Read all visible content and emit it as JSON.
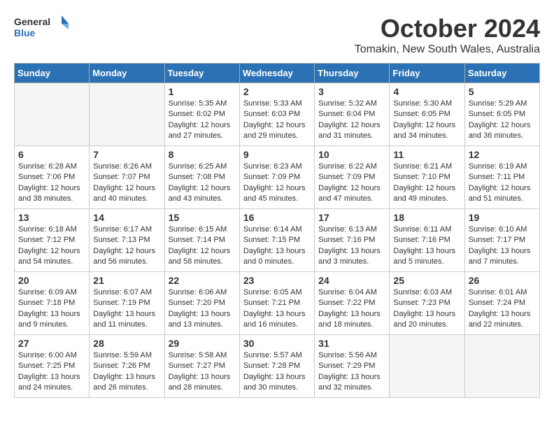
{
  "header": {
    "logo_line1": "General",
    "logo_line2": "Blue",
    "month": "October 2024",
    "location": "Tomakin, New South Wales, Australia"
  },
  "weekdays": [
    "Sunday",
    "Monday",
    "Tuesday",
    "Wednesday",
    "Thursday",
    "Friday",
    "Saturday"
  ],
  "weeks": [
    [
      {
        "day": "",
        "info": ""
      },
      {
        "day": "",
        "info": ""
      },
      {
        "day": "1",
        "info": "Sunrise: 5:35 AM\nSunset: 6:02 PM\nDaylight: 12 hours\nand 27 minutes."
      },
      {
        "day": "2",
        "info": "Sunrise: 5:33 AM\nSunset: 6:03 PM\nDaylight: 12 hours\nand 29 minutes."
      },
      {
        "day": "3",
        "info": "Sunrise: 5:32 AM\nSunset: 6:04 PM\nDaylight: 12 hours\nand 31 minutes."
      },
      {
        "day": "4",
        "info": "Sunrise: 5:30 AM\nSunset: 6:05 PM\nDaylight: 12 hours\nand 34 minutes."
      },
      {
        "day": "5",
        "info": "Sunrise: 5:29 AM\nSunset: 6:05 PM\nDaylight: 12 hours\nand 36 minutes."
      }
    ],
    [
      {
        "day": "6",
        "info": "Sunrise: 6:28 AM\nSunset: 7:06 PM\nDaylight: 12 hours\nand 38 minutes."
      },
      {
        "day": "7",
        "info": "Sunrise: 6:26 AM\nSunset: 7:07 PM\nDaylight: 12 hours\nand 40 minutes."
      },
      {
        "day": "8",
        "info": "Sunrise: 6:25 AM\nSunset: 7:08 PM\nDaylight: 12 hours\nand 43 minutes."
      },
      {
        "day": "9",
        "info": "Sunrise: 6:23 AM\nSunset: 7:09 PM\nDaylight: 12 hours\nand 45 minutes."
      },
      {
        "day": "10",
        "info": "Sunrise: 6:22 AM\nSunset: 7:09 PM\nDaylight: 12 hours\nand 47 minutes."
      },
      {
        "day": "11",
        "info": "Sunrise: 6:21 AM\nSunset: 7:10 PM\nDaylight: 12 hours\nand 49 minutes."
      },
      {
        "day": "12",
        "info": "Sunrise: 6:19 AM\nSunset: 7:11 PM\nDaylight: 12 hours\nand 51 minutes."
      }
    ],
    [
      {
        "day": "13",
        "info": "Sunrise: 6:18 AM\nSunset: 7:12 PM\nDaylight: 12 hours\nand 54 minutes."
      },
      {
        "day": "14",
        "info": "Sunrise: 6:17 AM\nSunset: 7:13 PM\nDaylight: 12 hours\nand 56 minutes."
      },
      {
        "day": "15",
        "info": "Sunrise: 6:15 AM\nSunset: 7:14 PM\nDaylight: 12 hours\nand 58 minutes."
      },
      {
        "day": "16",
        "info": "Sunrise: 6:14 AM\nSunset: 7:15 PM\nDaylight: 13 hours\nand 0 minutes."
      },
      {
        "day": "17",
        "info": "Sunrise: 6:13 AM\nSunset: 7:16 PM\nDaylight: 13 hours\nand 3 minutes."
      },
      {
        "day": "18",
        "info": "Sunrise: 6:11 AM\nSunset: 7:16 PM\nDaylight: 13 hours\nand 5 minutes."
      },
      {
        "day": "19",
        "info": "Sunrise: 6:10 AM\nSunset: 7:17 PM\nDaylight: 13 hours\nand 7 minutes."
      }
    ],
    [
      {
        "day": "20",
        "info": "Sunrise: 6:09 AM\nSunset: 7:18 PM\nDaylight: 13 hours\nand 9 minutes."
      },
      {
        "day": "21",
        "info": "Sunrise: 6:07 AM\nSunset: 7:19 PM\nDaylight: 13 hours\nand 11 minutes."
      },
      {
        "day": "22",
        "info": "Sunrise: 6:06 AM\nSunset: 7:20 PM\nDaylight: 13 hours\nand 13 minutes."
      },
      {
        "day": "23",
        "info": "Sunrise: 6:05 AM\nSunset: 7:21 PM\nDaylight: 13 hours\nand 16 minutes."
      },
      {
        "day": "24",
        "info": "Sunrise: 6:04 AM\nSunset: 7:22 PM\nDaylight: 13 hours\nand 18 minutes."
      },
      {
        "day": "25",
        "info": "Sunrise: 6:03 AM\nSunset: 7:23 PM\nDaylight: 13 hours\nand 20 minutes."
      },
      {
        "day": "26",
        "info": "Sunrise: 6:01 AM\nSunset: 7:24 PM\nDaylight: 13 hours\nand 22 minutes."
      }
    ],
    [
      {
        "day": "27",
        "info": "Sunrise: 6:00 AM\nSunset: 7:25 PM\nDaylight: 13 hours\nand 24 minutes."
      },
      {
        "day": "28",
        "info": "Sunrise: 5:59 AM\nSunset: 7:26 PM\nDaylight: 13 hours\nand 26 minutes."
      },
      {
        "day": "29",
        "info": "Sunrise: 5:58 AM\nSunset: 7:27 PM\nDaylight: 13 hours\nand 28 minutes."
      },
      {
        "day": "30",
        "info": "Sunrise: 5:57 AM\nSunset: 7:28 PM\nDaylight: 13 hours\nand 30 minutes."
      },
      {
        "day": "31",
        "info": "Sunrise: 5:56 AM\nSunset: 7:29 PM\nDaylight: 13 hours\nand 32 minutes."
      },
      {
        "day": "",
        "info": ""
      },
      {
        "day": "",
        "info": ""
      }
    ]
  ]
}
